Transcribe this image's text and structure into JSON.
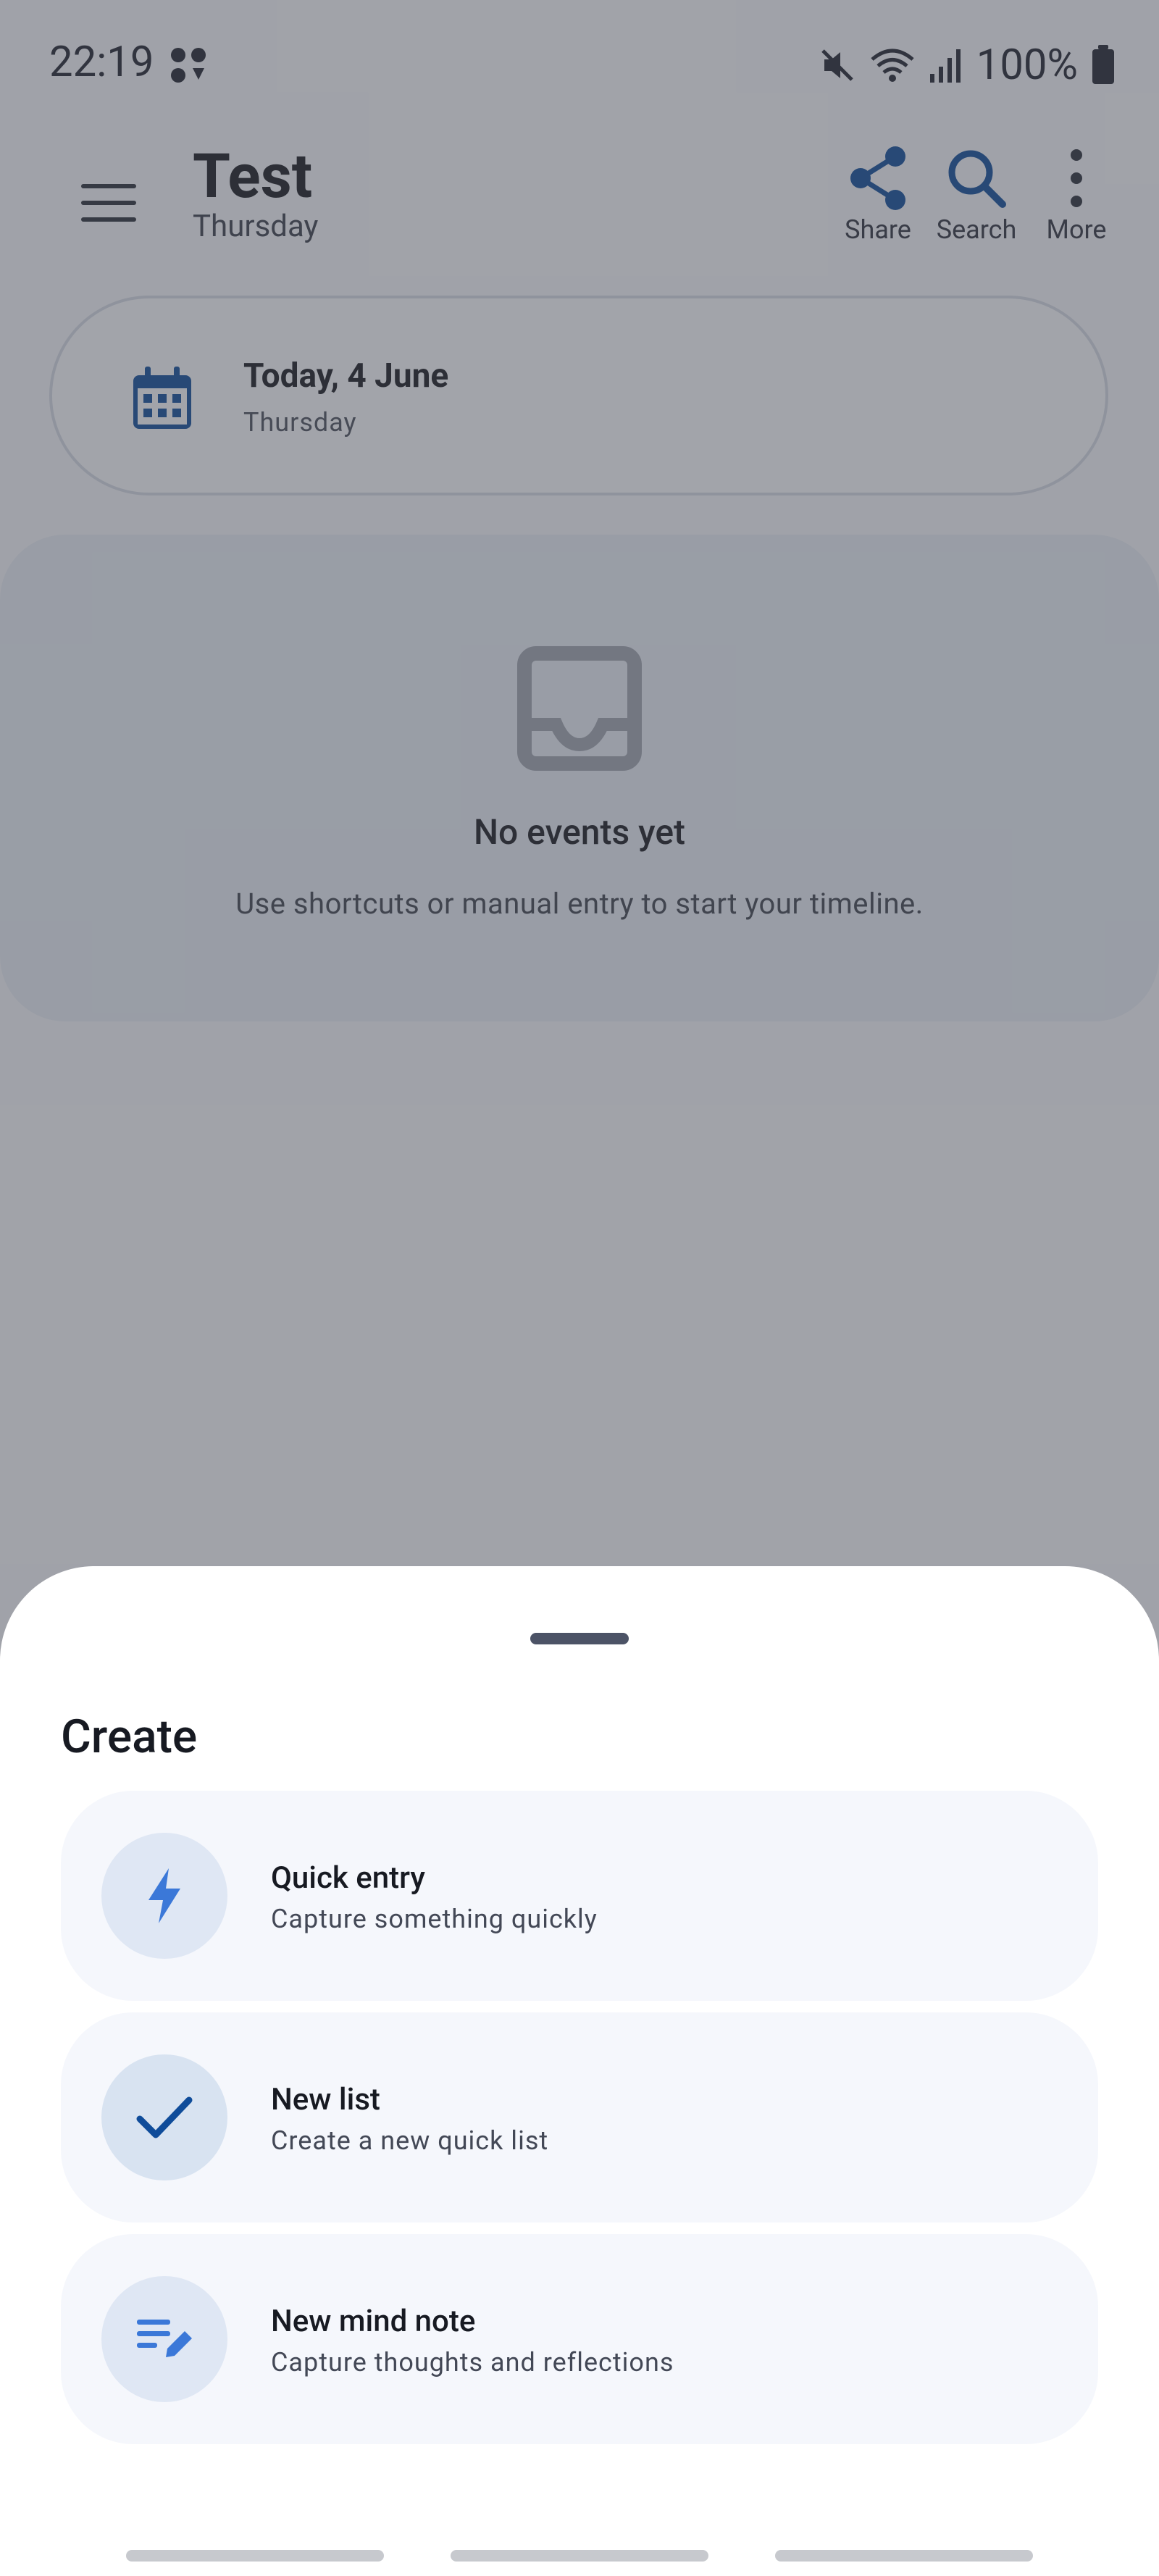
{
  "status_bar": {
    "time": "22:19",
    "battery": "100%"
  },
  "header": {
    "title": "Test",
    "subtitle": "Thursday",
    "actions": [
      {
        "label": "Share",
        "icon": "share-icon"
      },
      {
        "label": "Search",
        "icon": "search-icon"
      },
      {
        "label": "More",
        "icon": "more-vert-icon"
      }
    ]
  },
  "date_card": {
    "title": "Today, 4 June",
    "subtitle": "Thursday",
    "icon": "calendar-icon"
  },
  "empty_state": {
    "title": "No events yet",
    "message": "Use shortcuts or manual entry to start your timeline.",
    "icon": "inbox-icon"
  },
  "sheet": {
    "title": "Create",
    "options": [
      {
        "title": "Quick entry",
        "subtitle": "Capture something quickly",
        "icon": "bolt-icon"
      },
      {
        "title": "New list",
        "subtitle": "Create a new quick list",
        "icon": "check-icon"
      },
      {
        "title": "New mind note",
        "subtitle": "Capture thoughts and reflections",
        "icon": "edit-note-icon"
      }
    ]
  },
  "colors": {
    "accent": "#0f4c9a",
    "light_accent": "#3b78d8",
    "scrim": "#808390",
    "sheet_bg": "#ffffff",
    "option_bg": "#f5f7fc",
    "option_circle": "#dfe7f4"
  }
}
